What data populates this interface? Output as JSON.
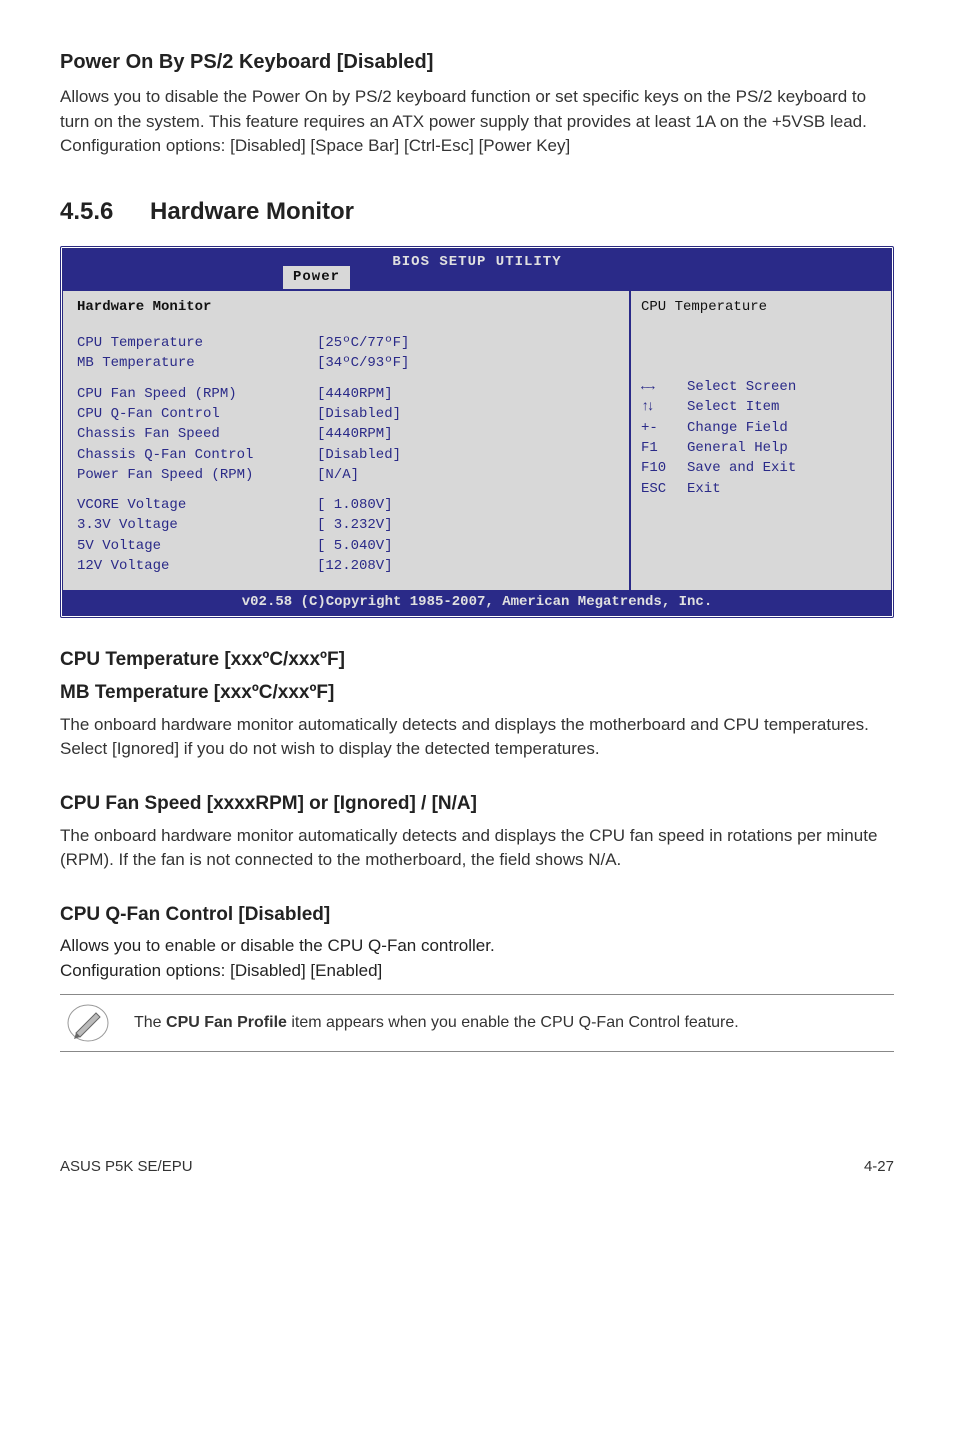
{
  "top": {
    "title": "Power On By PS/2 Keyboard [Disabled]",
    "para1": "Allows you to disable the Power On by PS/2 keyboard function or set specific keys on the PS/2 keyboard to turn on the system. This feature requires an ATX power supply that provides at least 1A on the +5VSB lead.",
    "para2": "Configuration options: [Disabled] [Space Bar] [Ctrl-Esc] [Power Key]"
  },
  "section": {
    "num": "4.5.6",
    "title": "Hardware Monitor"
  },
  "bios": {
    "header": "BIOS SETUP UTILITY",
    "tab": "Power",
    "left_title": "Hardware Monitor",
    "rows_a": [
      {
        "lbl": "CPU Temperature",
        "val": "[25ºC/77ºF]"
      },
      {
        "lbl": "MB Temperature",
        "val": "[34ºC/93ºF]"
      }
    ],
    "rows_b": [
      {
        "lbl": "CPU Fan Speed (RPM)",
        "val": "[4440RPM]"
      },
      {
        "lbl": "CPU Q-Fan Control",
        "val": "[Disabled]"
      },
      {
        "lbl": "Chassis Fan Speed",
        "val": "[4440RPM]"
      },
      {
        "lbl": "Chassis Q-Fan Control",
        "val": "[Disabled]"
      },
      {
        "lbl": "Power Fan Speed (RPM)",
        "val": "[N/A]"
      }
    ],
    "rows_c": [
      {
        "lbl": "VCORE Voltage",
        "val": "[ 1.080V]"
      },
      {
        "lbl": "3.3V Voltage",
        "val": "[ 3.232V]"
      },
      {
        "lbl": "5V Voltage",
        "val": "[ 5.040V]"
      },
      {
        "lbl": "12V Voltage",
        "val": "[12.208V]"
      }
    ],
    "right_title": "CPU Temperature",
    "help": [
      {
        "key_icon": "lr",
        "key": "",
        "txt": "Select Screen"
      },
      {
        "key_icon": "ud",
        "key": "",
        "txt": "Select Item"
      },
      {
        "key_icon": "",
        "key": "+-",
        "txt": "Change Field"
      },
      {
        "key_icon": "",
        "key": "F1",
        "txt": "General Help"
      },
      {
        "key_icon": "",
        "key": "F10",
        "txt": "Save and Exit"
      },
      {
        "key_icon": "",
        "key": "ESC",
        "txt": "Exit"
      }
    ],
    "footer": "v02.58 (C)Copyright 1985-2007, American Megatrends, Inc."
  },
  "temps": {
    "h1": "CPU Temperature [xxxºC/xxxºF]",
    "h2": "MB Temperature [xxxºC/xxxºF]",
    "p": "The onboard hardware monitor automatically detects and displays the motherboard and CPU temperatures. Select [Ignored] if you do not wish to display the detected temperatures."
  },
  "fan": {
    "h": "CPU Fan Speed [xxxxRPM] or [Ignored] / [N/A]",
    "p": "The onboard hardware monitor automatically detects and displays the CPU fan speed in rotations per minute (RPM). If the fan is not connected to the motherboard, the field shows N/A."
  },
  "qfan": {
    "h": "CPU Q-Fan Control [Disabled]",
    "p1": "Allows you to enable or disable the CPU Q-Fan controller.",
    "p2": "Configuration options: [Disabled] [Enabled]"
  },
  "note": {
    "prefix": "The ",
    "bold": "CPU Fan Profile",
    "suffix": " item appears when you enable the CPU Q-Fan Control feature."
  },
  "footer": {
    "left": "ASUS P5K SE/EPU",
    "right": "4-27"
  }
}
